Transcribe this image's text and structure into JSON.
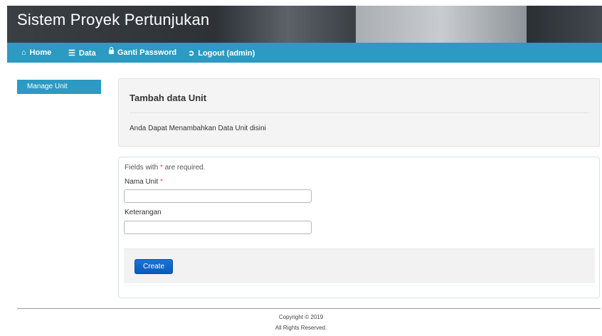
{
  "header": {
    "title": "Sistem Proyek Pertunjukan"
  },
  "nav": {
    "items": [
      {
        "icon": "home-icon",
        "label": "Home"
      },
      {
        "icon": "list-icon",
        "label": "Data"
      },
      {
        "icon": "lock-icon",
        "label": "Ganti Password"
      },
      {
        "icon": "logout-icon",
        "label": "Logout (admin)"
      }
    ]
  },
  "sidebar": {
    "items": [
      {
        "label": "Manage Unit"
      }
    ]
  },
  "intro": {
    "title": "Tambah data Unit",
    "description": "Anda Dapat Menambahkan Data Unit disini"
  },
  "form": {
    "required_note_prefix": "Fields with ",
    "required_marker": "*",
    "required_note_suffix": " are required.",
    "fields": [
      {
        "label": "Nama Unit",
        "required_marker": "*",
        "value": ""
      },
      {
        "label": "Keterangan",
        "value": ""
      }
    ],
    "submit_label": "Create"
  },
  "footer": {
    "copyright": "Copyright © 2019",
    "rights": "All Rights Reserved."
  },
  "colors": {
    "nav_bg": "#2c9ac2",
    "button_primary": "#0a5bbd",
    "required_marker": "#e74c3c"
  }
}
